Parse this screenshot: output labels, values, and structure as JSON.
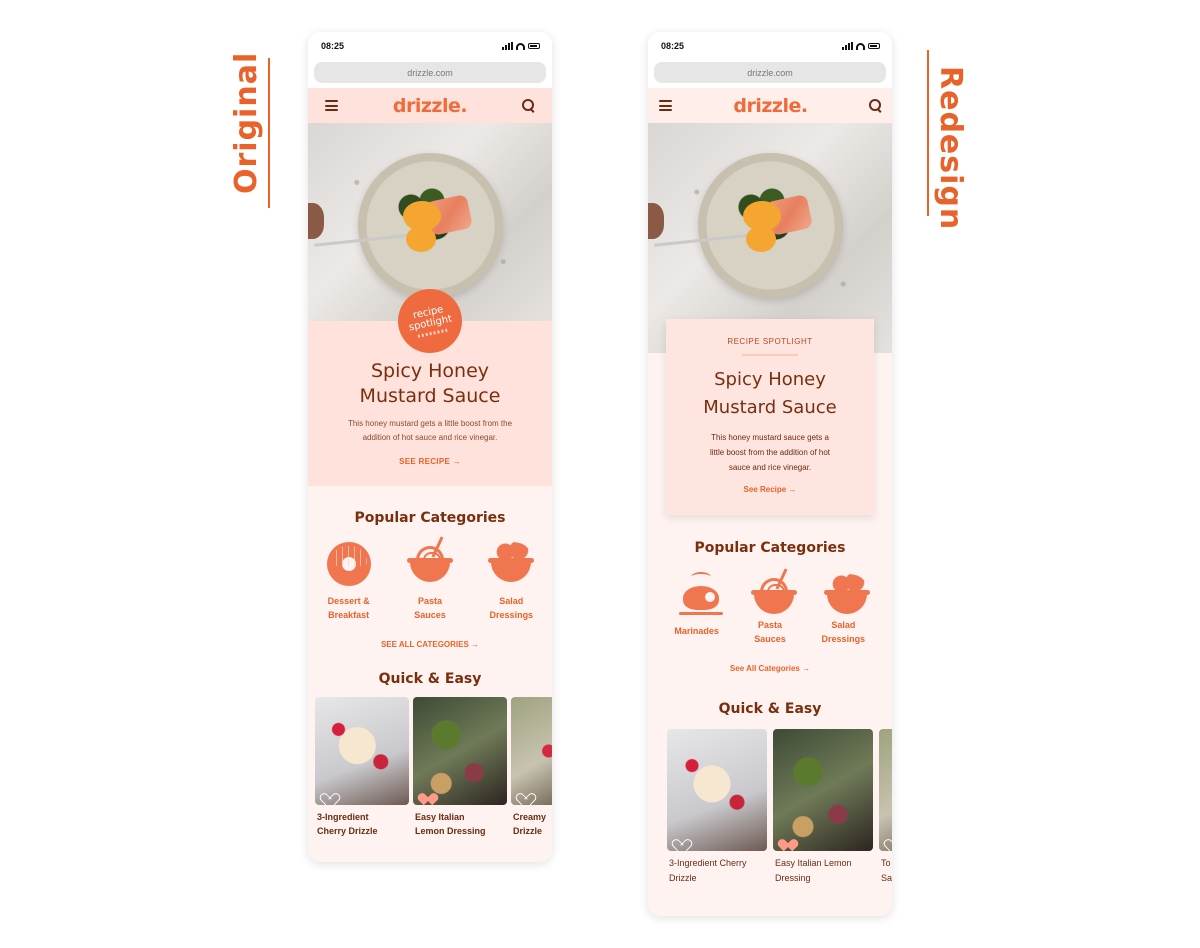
{
  "labels": {
    "original": "Original",
    "redesign": "Redesign"
  },
  "colors": {
    "accent": "#e8622a",
    "brand": "#f06b3a",
    "text_dark": "#7a2e0e",
    "peach": "#ffe2db"
  },
  "original": {
    "status_time": "08:25",
    "url": "drizzle.com",
    "brand": "drizzle.",
    "badge_line1": "recipe",
    "badge_line2": "spotlight",
    "spotlight_title_line1": "Spicy Honey",
    "spotlight_title_line2": "Mustard Sauce",
    "spotlight_desc_line1": "This honey mustard gets a little boost from the",
    "spotlight_desc_line2": "addition of hot sauce and rice vinegar.",
    "see_recipe": "SEE RECIPE →",
    "popular_title": "Popular Categories",
    "categories": [
      {
        "line1": "Dessert &",
        "line2": "Breakfast",
        "icon": "donut-icon"
      },
      {
        "line1": "Pasta",
        "line2": "Sauces",
        "icon": "pasta-bowl-icon"
      },
      {
        "line1": "Salad",
        "line2": "Dressings",
        "icon": "salad-bowl-icon"
      }
    ],
    "see_all": "SEE ALL CATEGORIES →",
    "quick_title": "Quick & Easy",
    "recipes": [
      {
        "line1": "3-Ingredient",
        "line2": "Cherry Drizzle",
        "liked": false
      },
      {
        "line1": "Easy Italian",
        "line2": "Lemon Dressing",
        "liked": true
      },
      {
        "line1": "Creamy",
        "line2": "Drizzle",
        "liked": false
      }
    ]
  },
  "redesign": {
    "status_time": "08:25",
    "url": "drizzle.com",
    "brand": "drizzle.",
    "kicker": "RECIPE SPOTLIGHT",
    "spotlight_title_line1": "Spicy Honey",
    "spotlight_title_line2": "Mustard Sauce",
    "spotlight_desc_line1": "This honey mustard sauce gets a",
    "spotlight_desc_line2": "little boost from the addition of hot",
    "spotlight_desc_line3": "sauce and rice vinegar.",
    "see_recipe": "See Recipe →",
    "popular_title": "Popular Categories",
    "categories": [
      {
        "line1": "Marinades",
        "line2": "",
        "icon": "roast-chicken-icon"
      },
      {
        "line1": "Pasta",
        "line2": "Sauces",
        "icon": "pasta-bowl-icon"
      },
      {
        "line1": "Salad",
        "line2": "Dressings",
        "icon": "salad-bowl-icon"
      }
    ],
    "see_all": "See All Categories →",
    "quick_title": "Quick & Easy",
    "recipes": [
      {
        "line1": "3-Ingredient Cherry",
        "line2": "Drizzle",
        "liked": false
      },
      {
        "line1": "Easy Italian Lemon",
        "line2": "Dressing",
        "liked": true
      },
      {
        "line1": "To",
        "line2": "Sa",
        "liked": false
      }
    ]
  }
}
